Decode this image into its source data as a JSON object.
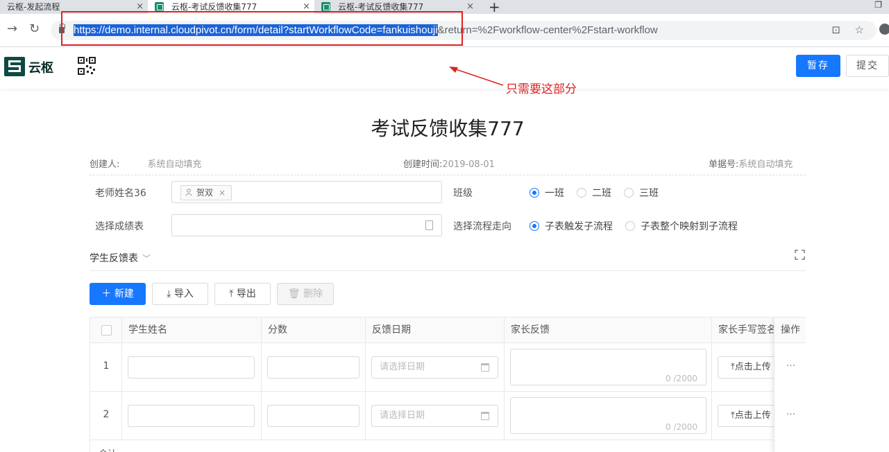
{
  "browser": {
    "tabs": [
      {
        "label": "云枢-发起流程",
        "close": "×"
      },
      {
        "label": "云枢-考试反馈收集777",
        "close": "×"
      },
      {
        "label": "云枢-考试反馈收集777",
        "close": "×"
      }
    ],
    "new_tab": "+",
    "url_selected": "https://demo.internal.cloudpivot.cn/form/detail?startWorkflowCode=fankuishouji",
    "url_rest": "&return=%2Fworkflow-center%2Fstart-workflow"
  },
  "annotation": {
    "text": "只需要这部分",
    "color": "#e02020"
  },
  "app": {
    "logo_text": "云枢",
    "save_button": "暂存",
    "submit_button": "提交",
    "accent": "#1677ff"
  },
  "form": {
    "title": "考试反馈收集777",
    "meta": {
      "creator_label": "创建人:",
      "creator_value": "系统自动填充",
      "created_time_label": "创建时间:",
      "created_time_value": "2019-08-01",
      "doc_no_label": "单据号:",
      "doc_no_value": "系统自动填充"
    },
    "teacher_label": "老师姓名36",
    "teacher_value": "贺双",
    "class_label": "班级",
    "class_options": [
      "一班",
      "二班",
      "三班"
    ],
    "score_sheet_label": "选择成绩表",
    "flow_label": "选择流程走向",
    "flow_options": [
      "子表触发子流程",
      "子表整个映射到子流程"
    ]
  },
  "subtable": {
    "title": "学生反馈表",
    "buttons": {
      "new": "新建",
      "import": "导入",
      "export": "导出",
      "delete": "删除"
    },
    "columns": [
      "学生姓名",
      "分数",
      "反馈日期",
      "家长反馈",
      "家长手写签名",
      "操作"
    ],
    "date_placeholder": "请选择日期",
    "counter": "0 /2000",
    "upload_label": "点击上传",
    "ops": "···",
    "rows": [
      {
        "index": "1"
      },
      {
        "index": "2"
      }
    ],
    "sum_label": "合计"
  }
}
